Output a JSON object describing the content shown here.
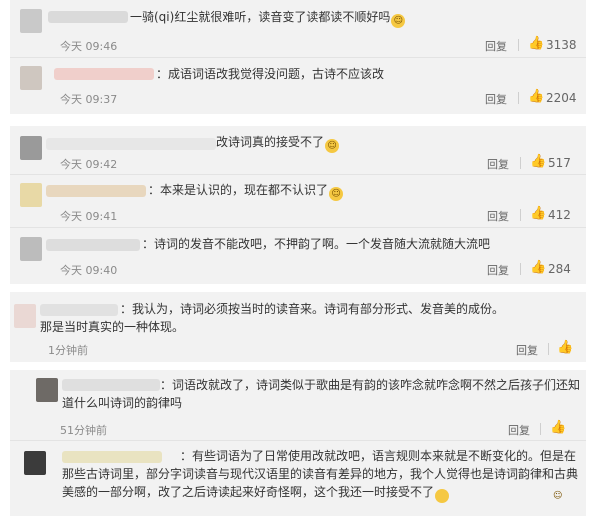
{
  "comments": [
    {
      "text": "一骑(qi)红尘就很难听，读音变了读都读不顺好吗",
      "emoji": "☺",
      "time": "今天 09:46",
      "reply": "回复",
      "thumb": "👍",
      "likes": "3138"
    },
    {
      "text": "：成语词语改我觉得没问题，古诗不应该改",
      "emoji": "",
      "time": "今天 09:37",
      "reply": "回复",
      "thumb": "👍",
      "likes": "2204"
    },
    {
      "text": "改诗词真的接受不了",
      "emoji": "☺",
      "time": "今天 09:42",
      "reply": "回复",
      "thumb": "👍",
      "likes": "517"
    },
    {
      "text": "：本来是认识的，现在都不认识了",
      "emoji": "☺",
      "time": "今天 09:41",
      "reply": "回复",
      "thumb": "👍",
      "likes": "412"
    },
    {
      "text": "：诗词的发音不能改吧，不押韵了啊。一个发音随大流就随大流吧",
      "emoji": "",
      "time": "今天 09:40",
      "reply": "回复",
      "thumb": "👍",
      "likes": "284"
    },
    {
      "text": "：我认为，诗词必须按当时的读音来。诗词有部分形式、发音美的成份。那是当时真实的一种体现。",
      "emoji": "",
      "time": "1分钟前",
      "reply": "回复",
      "thumb": "👍",
      "likes": ""
    },
    {
      "text": "：词语改就改了，诗词类似于歌曲是有韵的该咋念就咋念啊不然之后孩子们还知道什么叫诗词的韵律吗",
      "emoji": "",
      "time": "51分钟前",
      "reply": "回复",
      "thumb": "👍",
      "likes": ""
    },
    {
      "text": "：有些词语为了日常使用改就改吧，语言规则本来就是不断变化的。但是在那些古诗词里，部分字词读音与现代汉语里的读音有差异的地方，我个人觉得也是诗词韵律和古典美感的一部分啊，改了之后诗读起来好奇怪啊，这个我还一时接受不了",
      "emoji": "☺",
      "time": "",
      "reply": "",
      "thumb": "",
      "likes": ""
    }
  ]
}
